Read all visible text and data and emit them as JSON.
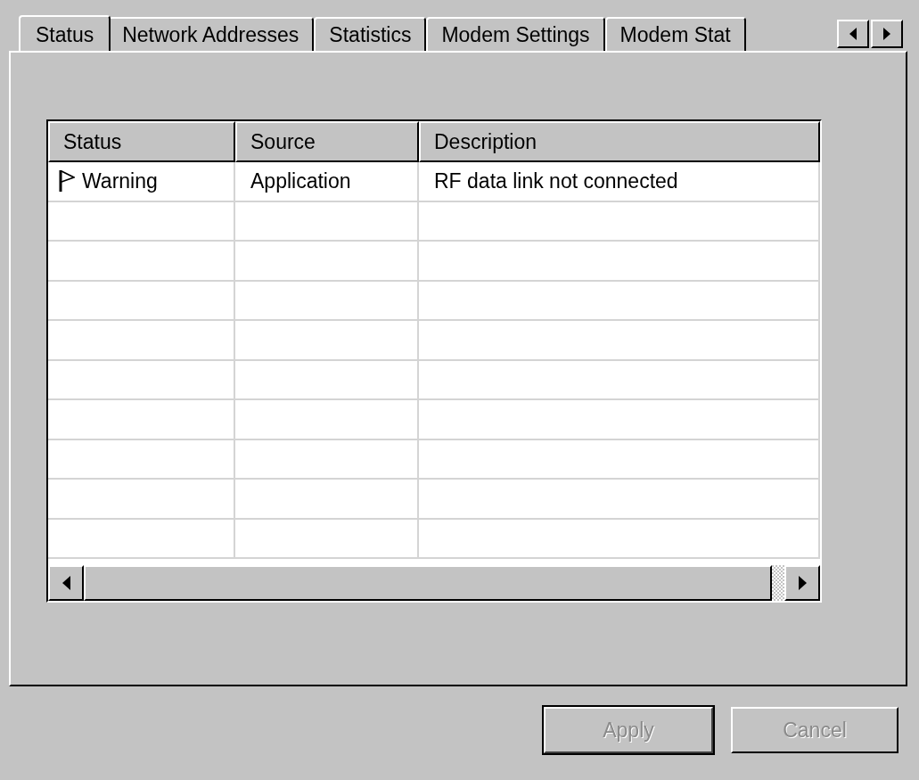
{
  "tabs": [
    {
      "label": "Status",
      "selected": true
    },
    {
      "label": "Network Addresses",
      "selected": false
    },
    {
      "label": "Statistics",
      "selected": false
    },
    {
      "label": "Modem Settings",
      "selected": false
    },
    {
      "label": "Modem Stat",
      "selected": false
    }
  ],
  "table": {
    "columns": [
      "Status",
      "Source",
      "Description"
    ],
    "rows": [
      {
        "status": "Warning",
        "source": "Application",
        "description": "RF data link not connected"
      }
    ]
  },
  "buttons": [
    {
      "label": "Apply",
      "default": true,
      "disabled": true
    },
    {
      "label": "Cancel",
      "default": false,
      "disabled": true
    }
  ]
}
